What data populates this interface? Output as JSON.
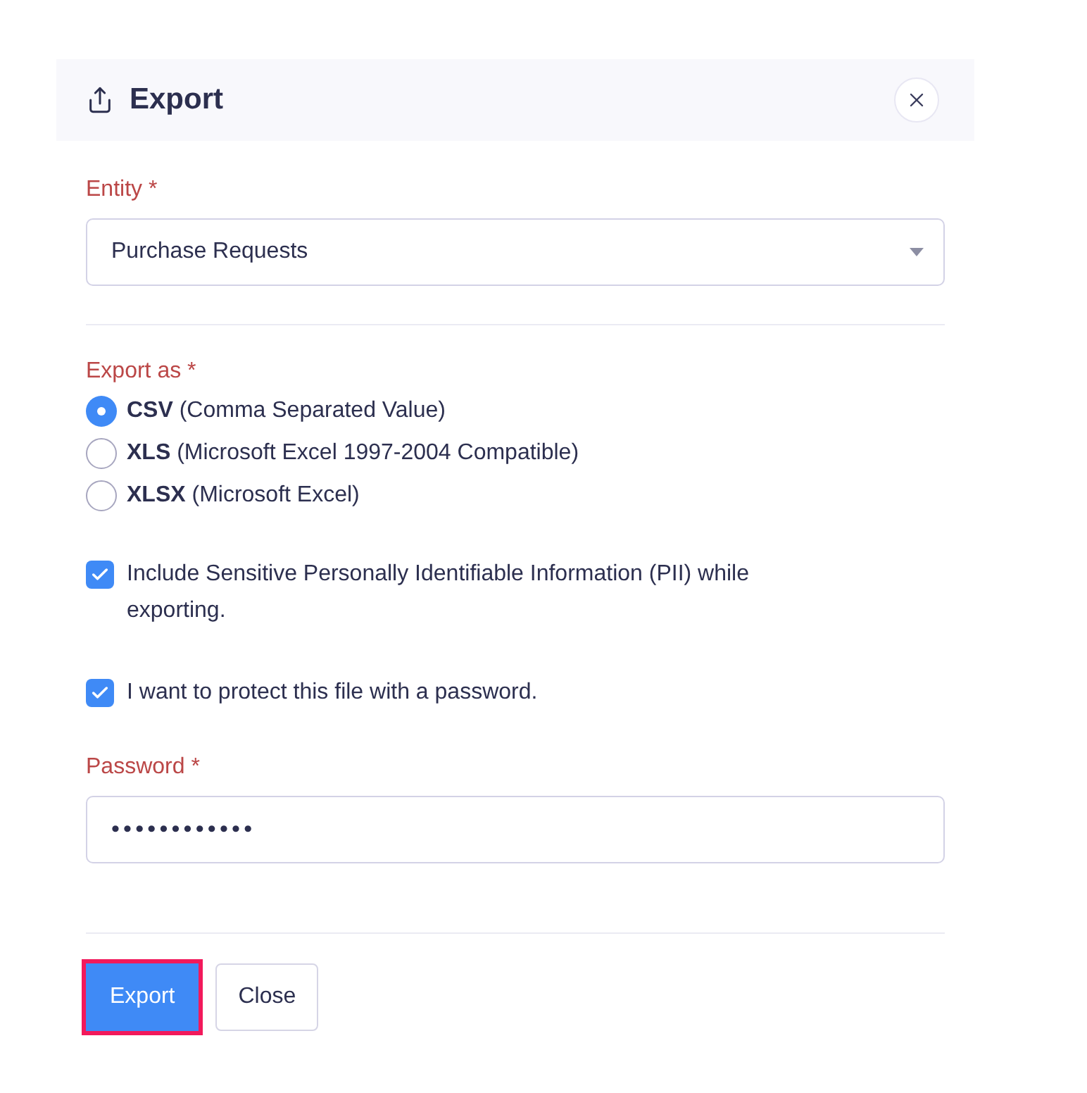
{
  "dialog": {
    "title": "Export"
  },
  "entity": {
    "label": "Entity *",
    "value": "Purchase Requests"
  },
  "export_as": {
    "label": "Export as *",
    "options": [
      {
        "label": "**CSV** (Comma Separated Value)",
        "selected": true
      },
      {
        "label": "**XLS** (Microsoft Excel 1997-2004 Compatible)",
        "selected": false
      },
      {
        "label": "**XLSX** (Microsoft Excel)",
        "selected": false
      }
    ]
  },
  "checkboxes": [
    {
      "label": "Include Sensitive Personally Identifiable Information (PII) while exporting.",
      "checked": true
    },
    {
      "label": "I want to protect this file with a password.",
      "checked": true
    }
  ],
  "password": {
    "label": "Password *",
    "value": "••••••••••••"
  },
  "buttons": [
    {
      "label": "Export",
      "kind": "primary",
      "focused": true
    },
    {
      "label": "Close",
      "kind": "secondary",
      "focused": false
    }
  ]
}
